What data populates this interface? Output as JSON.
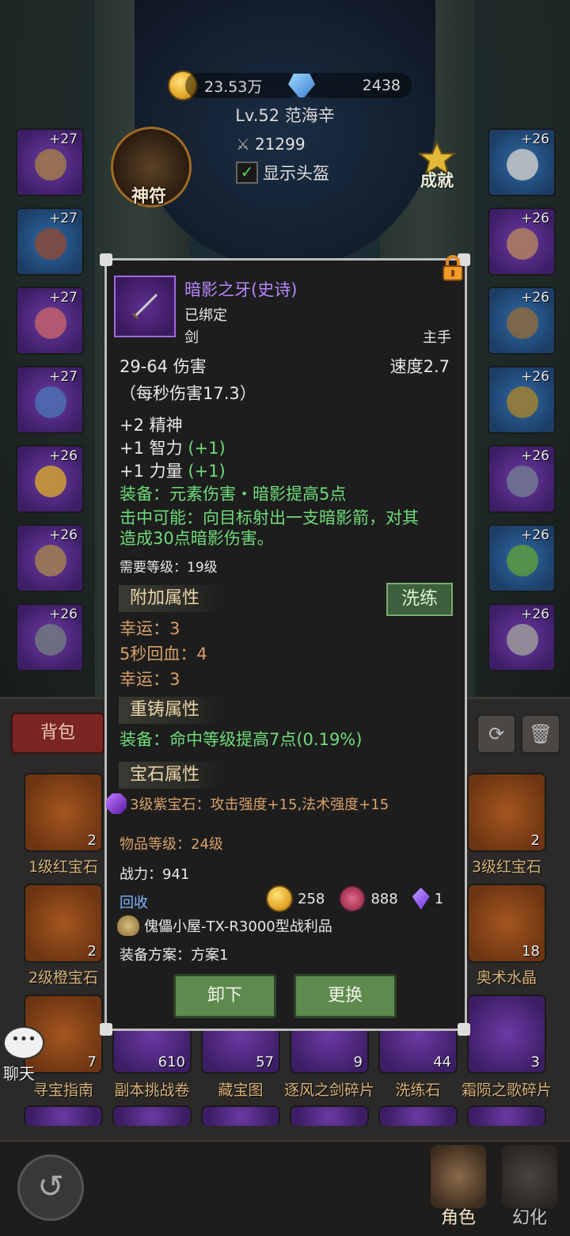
{
  "header": {
    "gold": "23.53万",
    "diamonds": "2438",
    "level_name": "Lv.52 范海辛",
    "combat_power": "21299",
    "show_helmet": "显示头盔",
    "rune_label": "神符",
    "achievement_label": "成就"
  },
  "equip_left": [
    "+27",
    "+27",
    "+27",
    "+27",
    "+26",
    "+26",
    "+26"
  ],
  "equip_right": [
    "+26",
    "+26",
    "+26",
    "+26",
    "+26",
    "+26",
    "+26"
  ],
  "tooltip": {
    "name": "暗影之牙(史诗)",
    "bound": "已绑定",
    "type": "剑",
    "slot": "主手",
    "damage": "29-64 伤害",
    "speed": "速度2.7",
    "dps": "（每秒伤害17.3）",
    "stats": [
      "+2 精神",
      "+1 智力",
      "+1 力量"
    ],
    "stat_bonus": [
      "(+1)",
      "(+1)"
    ],
    "equip_effect": "装备：元素伤害・暗影提高5点",
    "proc_line1": "击中可能：向目标射出一支暗影箭，对其",
    "proc_line2": "造成30点暗影伤害。",
    "req_level": "需要等级：19级",
    "extra_title": "附加属性",
    "wash": "洗练",
    "extra": [
      "幸运：3",
      "5秒回血：4",
      "幸运：3"
    ],
    "reforge_title": "重铸属性",
    "reforge": "装备：命中等级提高7点(0.19%)",
    "gem_title": "宝石属性",
    "gem": "3级紫宝石：攻击强度+15,法术强度+15",
    "item_level": "物品等级：24级",
    "power": "战力：941",
    "recycle": "回收",
    "recycle_gold": "258",
    "recycle_dust": "888",
    "recycle_crystal": "1",
    "source": "傀儡小屋-TX-R3000型战利品",
    "plan": "装备方案：方案1",
    "unequip": "卸下",
    "replace": "更换"
  },
  "bag": {
    "tab": "背包",
    "items": [
      {
        "name": "1级红宝石",
        "count": "2"
      },
      {
        "name": "3级红宝石",
        "count": "2"
      },
      {
        "name": "2级橙宝石",
        "count": "2"
      },
      {
        "name": "奥术水晶",
        "count": "18"
      },
      {
        "name": "寻宝指南",
        "count": "7"
      },
      {
        "name": "副本挑战卷",
        "count": "610"
      },
      {
        "name": "藏宝图",
        "count": "57"
      },
      {
        "name": "逐风之剑碎片",
        "count": "9"
      },
      {
        "name": "洗练石",
        "count": "44"
      },
      {
        "name": "霜陨之歌碎片",
        "count": "3"
      }
    ]
  },
  "chat_label": "聊天",
  "nav": {
    "character": "角色",
    "illusion": "幻化"
  },
  "colors": {
    "epic": "#b886ff",
    "green": "#6fdb7a",
    "gold_text": "#d8a06a"
  }
}
